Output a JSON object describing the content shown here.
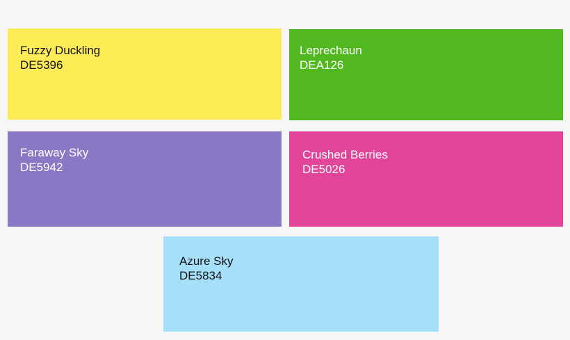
{
  "swatches": [
    {
      "name": "Fuzzy Duckling",
      "code": "DE5396",
      "bg": "#fdec56",
      "fg": "#111111"
    },
    {
      "name": "Leprechaun",
      "code": "DEA126",
      "bg": "#52b820",
      "fg": "#ffffff"
    },
    {
      "name": "Faraway Sky",
      "code": "DE5942",
      "bg": "#8b78c4",
      "fg": "#ffffff"
    },
    {
      "name": "Crushed Berries",
      "code": "DE5026",
      "bg": "#e04599",
      "fg": "#ffffff"
    },
    {
      "name": "Azure Sky",
      "code": "DE5834",
      "bg": "#a6dffa",
      "fg": "#111111"
    }
  ]
}
